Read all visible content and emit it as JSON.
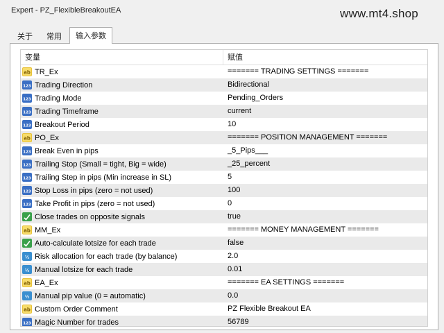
{
  "window": {
    "title": "Expert - PZ_FlexibleBreakoutEA",
    "watermark": "www.mt4.shop"
  },
  "tabs": [
    {
      "label": "关于",
      "active": false
    },
    {
      "label": "常用",
      "active": false
    },
    {
      "label": "输入参数",
      "active": true
    }
  ],
  "table": {
    "headers": {
      "variable": "变量",
      "value": "赋值"
    },
    "rows": [
      {
        "icon": "ab",
        "name": "TR_Ex",
        "value": "======= TRADING SETTINGS ======="
      },
      {
        "icon": "123",
        "name": "Trading Direction",
        "value": "Bidirectional"
      },
      {
        "icon": "123",
        "name": "Trading Mode",
        "value": "Pending_Orders"
      },
      {
        "icon": "123",
        "name": "Trading Timeframe",
        "value": "current"
      },
      {
        "icon": "123",
        "name": "Breakout Period",
        "value": "10"
      },
      {
        "icon": "ab",
        "name": "PO_Ex",
        "value": "======= POSITION MANAGEMENT ======="
      },
      {
        "icon": "123",
        "name": "Break Even in pips",
        "value": "_5_Pips___"
      },
      {
        "icon": "123",
        "name": "Trailing Stop (Small = tight, Big = wide)",
        "value": "_25_percent"
      },
      {
        "icon": "123",
        "name": "Trailing Step in pips (Min increase in SL)",
        "value": "5"
      },
      {
        "icon": "123",
        "name": "Stop Loss in pips (zero = not used)",
        "value": "100"
      },
      {
        "icon": "123",
        "name": "Take Profit in pips (zero = not used)",
        "value": "0"
      },
      {
        "icon": "bool",
        "name": "Close trades on opposite signals",
        "value": "true"
      },
      {
        "icon": "ab",
        "name": "MM_Ex",
        "value": "======= MONEY MANAGEMENT ======="
      },
      {
        "icon": "bool",
        "name": "Auto-calculate lotsize for each trade",
        "value": "false"
      },
      {
        "icon": "dbl",
        "name": "Risk allocation for each trade (by balance)",
        "value": "2.0"
      },
      {
        "icon": "dbl",
        "name": "Manual lotsize for each trade",
        "value": "0.01"
      },
      {
        "icon": "ab",
        "name": "EA_Ex",
        "value": "======= EA SETTINGS ======="
      },
      {
        "icon": "dbl",
        "name": "Manual pip value (0 = automatic)",
        "value": "0.0"
      },
      {
        "icon": "ab",
        "name": "Custom Order Comment",
        "value": "PZ Flexible Breakout EA"
      },
      {
        "icon": "123",
        "name": "Magic Number for trades",
        "value": "56789"
      }
    ]
  },
  "icon_colors": {
    "ab": "#e8c23a",
    "123": "#3a6fc4",
    "dbl": "#3a8fd0",
    "bool": "#3aa04a"
  }
}
